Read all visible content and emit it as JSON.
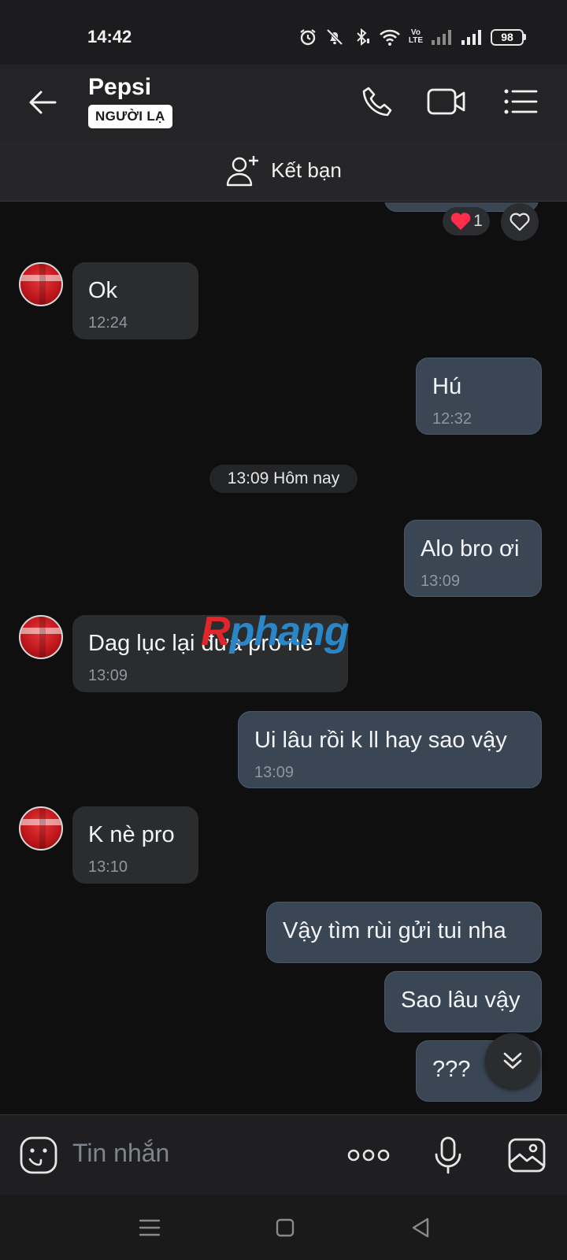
{
  "status_bar": {
    "time": "14:42",
    "battery": "98",
    "network_label": "Vo\nLTE0"
  },
  "header": {
    "contact_name": "Pepsi",
    "badge": "NGƯỜI LẠ"
  },
  "add_friend": {
    "label": "Kết bạn"
  },
  "reactions": {
    "heart_count": "1"
  },
  "messages": [
    {
      "dir": "in",
      "text": "Ok",
      "time": "12:24"
    },
    {
      "dir": "out",
      "text": "Hú",
      "time": "12:32"
    },
    {
      "dir": "out",
      "text": "Alo bro ơi",
      "time": "13:09"
    },
    {
      "dir": "in",
      "text": "Dag lục lại đưa pro nè",
      "time": "13:09"
    },
    {
      "dir": "out",
      "text": "Ui lâu rồi k ll hay sao vậy",
      "time": "13:09"
    },
    {
      "dir": "in",
      "text": "K nè pro",
      "time": "13:10"
    },
    {
      "dir": "out",
      "text": "Vậy tìm rùi gửi tui nha",
      "time": ""
    },
    {
      "dir": "out",
      "text": "Sao lâu vậy",
      "time": ""
    },
    {
      "dir": "out",
      "text": "???",
      "time": ""
    }
  ],
  "date_separator": "13:09 Hôm nay",
  "watermark": {
    "first": "R",
    "rest": "phang"
  },
  "composer": {
    "placeholder": "Tin nhắn"
  },
  "colors": {
    "incoming_bubble": "#2b2c2e",
    "outgoing_bubble": "#3a4654",
    "background": "#0f0f10",
    "accent_red": "#e0262b",
    "accent_blue": "#2a86c7"
  },
  "icons": [
    "back-arrow-icon",
    "phone-icon",
    "video-call-icon",
    "menu-list-icon",
    "add-friend-icon",
    "heart-icon",
    "chevron-double-down-icon",
    "emoji-icon",
    "more-dots-icon",
    "microphone-icon",
    "image-icon",
    "nav-menu-icon",
    "nav-home-icon",
    "nav-back-icon"
  ]
}
